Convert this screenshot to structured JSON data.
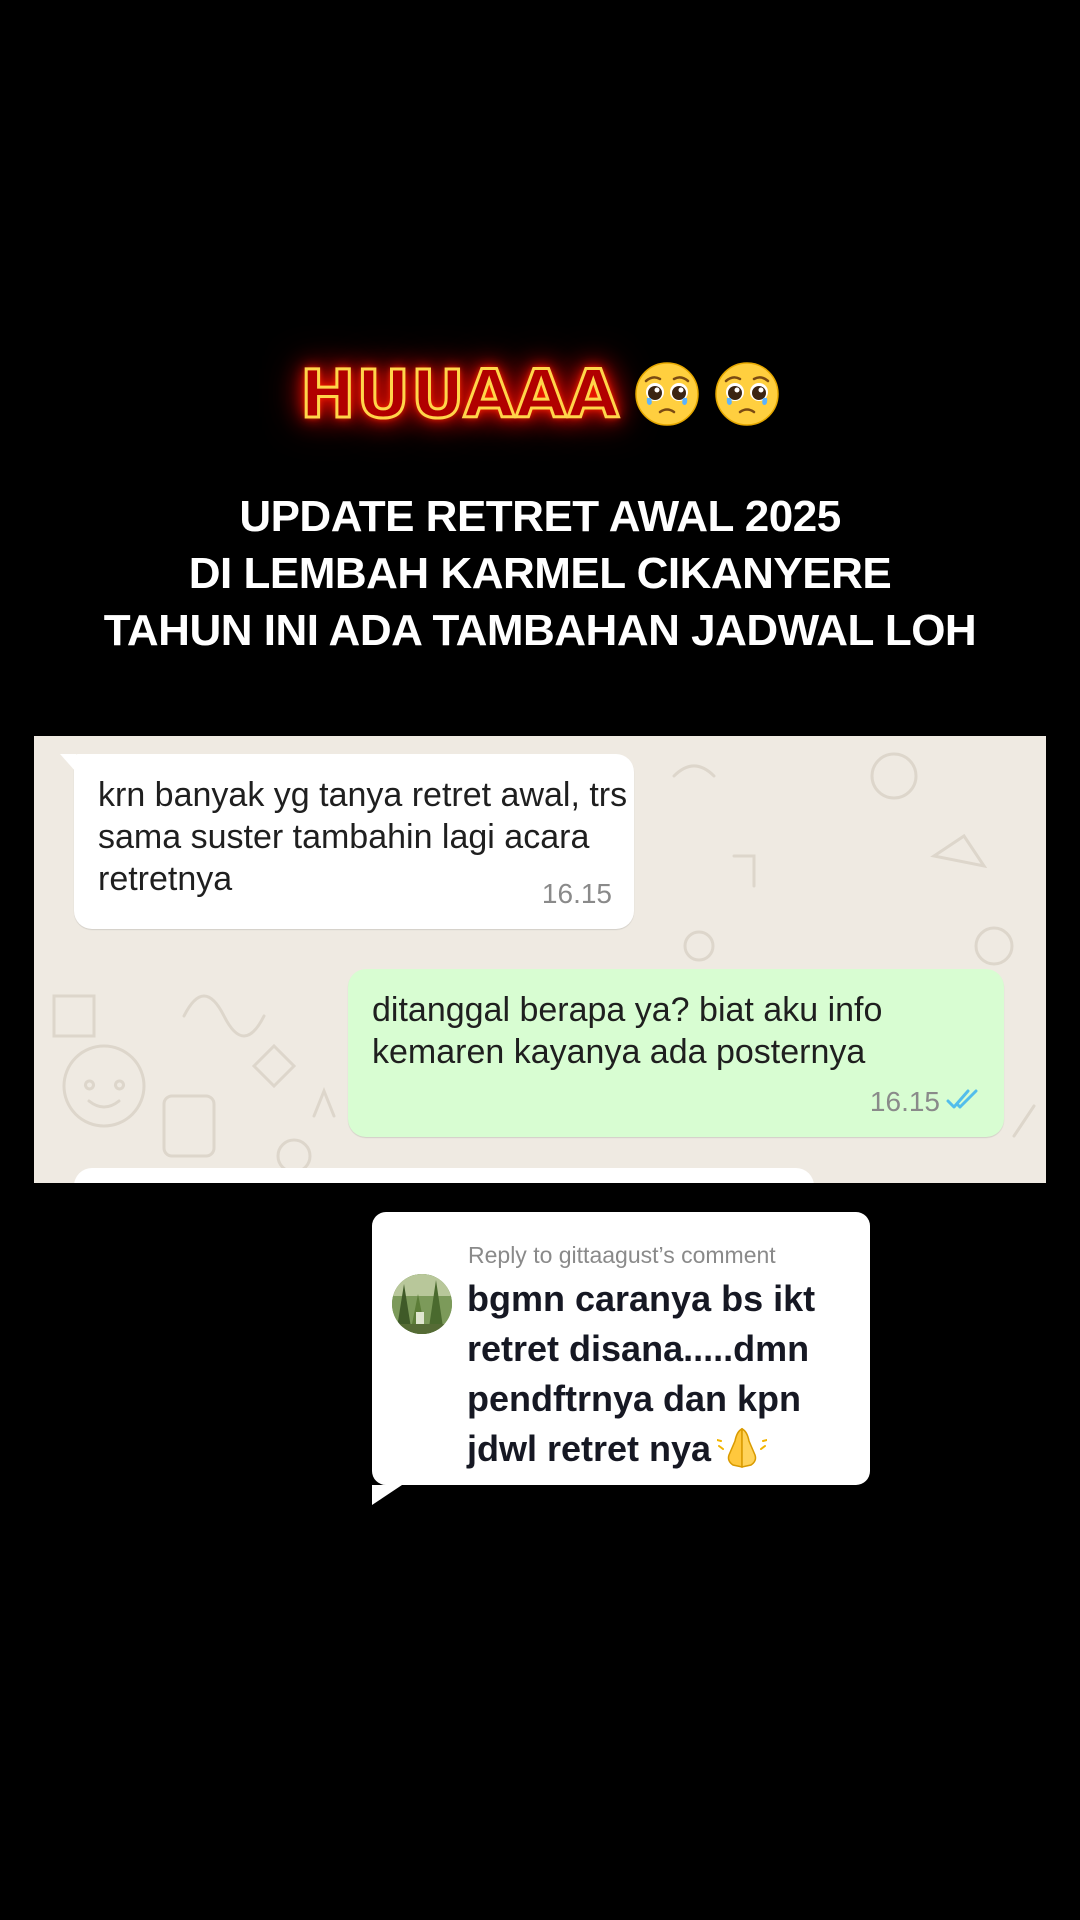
{
  "headline": {
    "text": "HUUAAA",
    "emoji": [
      "pleading-face-icon",
      "pleading-face-icon"
    ]
  },
  "caption": {
    "lines": [
      "UPDATE RETRET AWAL 2025",
      "DI LEMBAH KARMEL CIKANYERE",
      "TAHUN INI ADA TAMBAHAN JADWAL LOH"
    ]
  },
  "chat": {
    "messages": [
      {
        "direction": "incoming",
        "lines": [
          "krn banyak yg tanya retret awal, trs",
          "sama suster tambahin lagi acara",
          "retretnya"
        ],
        "time": "16.15"
      },
      {
        "direction": "outgoing",
        "lines": [
          "ditanggal berapa ya? biat aku info",
          "kemaren kayanya ada posternya"
        ],
        "time": "16.15",
        "status_icon": "double-check-icon",
        "status_color": "#53bdeb"
      }
    ]
  },
  "reply_card": {
    "header": "Reply to gittaagust’s comment",
    "avatar_icon": "forest-avatar",
    "body_lines": [
      "bgmn caranya bs ikt",
      "retret disana.....dmn",
      "pendftrnya dan kpn",
      "jdwl retret nya"
    ],
    "body_emoji": "folded-hands-icon"
  },
  "colors": {
    "background": "#000000",
    "neon_fill": "#b10000",
    "neon_outline": "#ffd54a",
    "chat_bg": "#efeae2",
    "incoming_bubble": "#ffffff",
    "outgoing_bubble": "#d8fdd2"
  }
}
